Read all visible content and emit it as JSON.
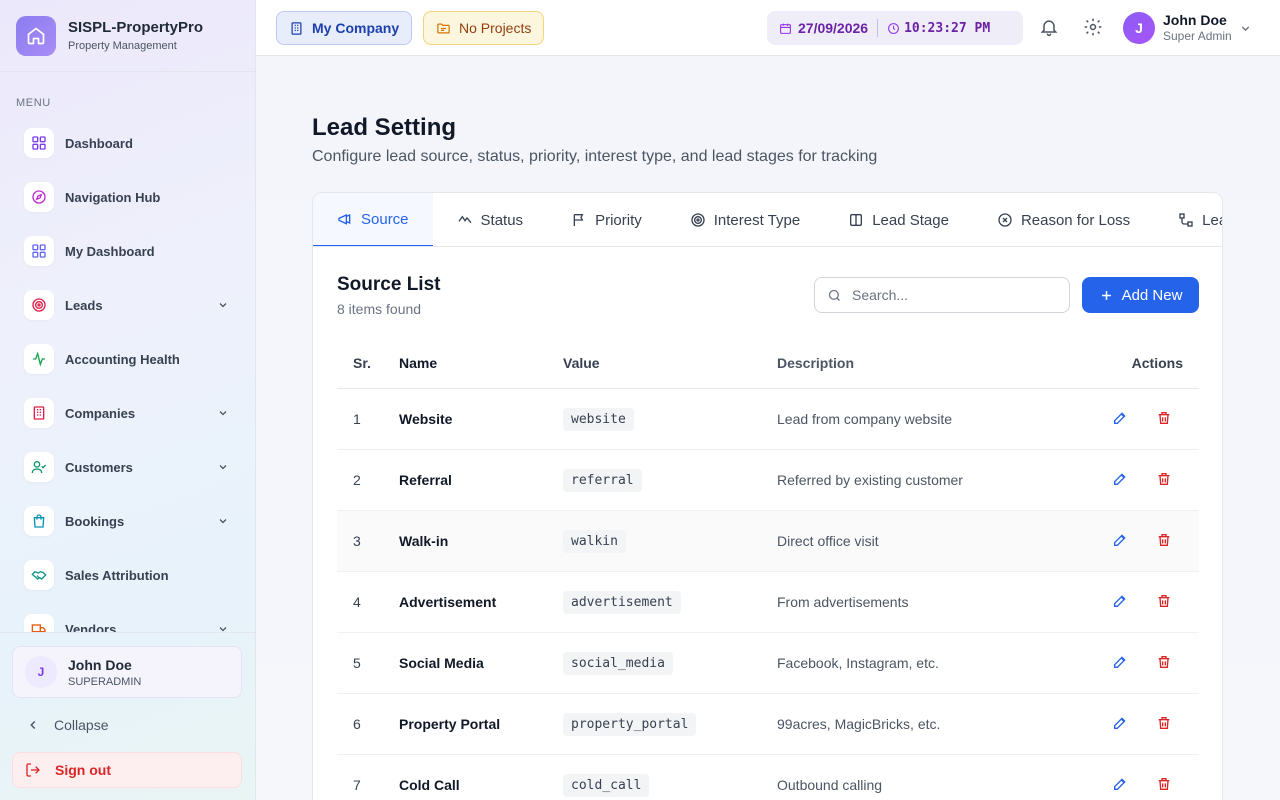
{
  "brand": {
    "name": "SISPL-PropertyPro",
    "subtitle": "Property Management"
  },
  "sidebar": {
    "menu_label": "MENU",
    "items": [
      {
        "label": "Dashboard",
        "icon": "grid-icon",
        "color": "#7c3aed",
        "has_children": false
      },
      {
        "label": "Navigation Hub",
        "icon": "compass-icon",
        "color": "#c026d3",
        "has_children": false
      },
      {
        "label": "My Dashboard",
        "icon": "grid-icon",
        "color": "#6366f1",
        "has_children": false
      },
      {
        "label": "Leads",
        "icon": "target-icon",
        "color": "#e11d48",
        "has_children": true
      },
      {
        "label": "Accounting Health",
        "icon": "activity-icon",
        "color": "#16a34a",
        "has_children": false
      },
      {
        "label": "Companies",
        "icon": "building-icon",
        "color": "#e11d48",
        "has_children": true
      },
      {
        "label": "Customers",
        "icon": "user-check-icon",
        "color": "#059669",
        "has_children": true
      },
      {
        "label": "Bookings",
        "icon": "shopping-bag-icon",
        "color": "#0891b2",
        "has_children": true
      },
      {
        "label": "Sales Attribution",
        "icon": "handshake-icon",
        "color": "#0d9488",
        "has_children": false
      },
      {
        "label": "Vendors",
        "icon": "truck-icon",
        "color": "#ea580c",
        "has_children": true
      }
    ],
    "user": {
      "initial": "J",
      "name": "John Doe",
      "role": "SUPERADMIN"
    },
    "collapse_label": "Collapse",
    "signout_label": "Sign out"
  },
  "topbar": {
    "company_label": "My Company",
    "project_label": "No Projects",
    "date": "27/09/2026",
    "time": "10:23:27 PM",
    "user": {
      "initial": "J",
      "name": "John Doe",
      "role": "Super Admin"
    }
  },
  "page": {
    "title": "Lead Setting",
    "subtitle": "Configure lead source, status, priority, interest type, and lead stages for tracking"
  },
  "tabs": [
    {
      "label": "Source",
      "icon": "megaphone-icon",
      "active": true
    },
    {
      "label": "Status",
      "icon": "activity-icon",
      "active": false
    },
    {
      "label": "Priority",
      "icon": "flag-icon",
      "active": false
    },
    {
      "label": "Interest Type",
      "icon": "target-icon",
      "active": false
    },
    {
      "label": "Lead Stage",
      "icon": "columns-icon",
      "active": false
    },
    {
      "label": "Reason for Loss",
      "icon": "x-circle-icon",
      "active": false
    },
    {
      "label": "Lea",
      "icon": "workflow-icon",
      "active": false
    }
  ],
  "list": {
    "title": "Source List",
    "count_text": "8 items found",
    "search_placeholder": "Search...",
    "add_label": "Add New",
    "columns": {
      "sr": "Sr.",
      "name": "Name",
      "value": "Value",
      "description": "Description",
      "actions": "Actions"
    },
    "rows": [
      {
        "sr": "1",
        "name": "Website",
        "value": "website",
        "description": "Lead from company website"
      },
      {
        "sr": "2",
        "name": "Referral",
        "value": "referral",
        "description": "Referred by existing customer"
      },
      {
        "sr": "3",
        "name": "Walk-in",
        "value": "walkin",
        "description": "Direct office visit"
      },
      {
        "sr": "4",
        "name": "Advertisement",
        "value": "advertisement",
        "description": "From advertisements"
      },
      {
        "sr": "5",
        "name": "Social Media",
        "value": "social_media",
        "description": "Facebook, Instagram, etc."
      },
      {
        "sr": "6",
        "name": "Property Portal",
        "value": "property_portal",
        "description": "99acres, MagicBricks, etc."
      },
      {
        "sr": "7",
        "name": "Cold Call",
        "value": "cold_call",
        "description": "Outbound calling"
      }
    ]
  },
  "colors": {
    "primary": "#2563eb",
    "danger": "#dc2626",
    "accent": "#7c3aed"
  }
}
